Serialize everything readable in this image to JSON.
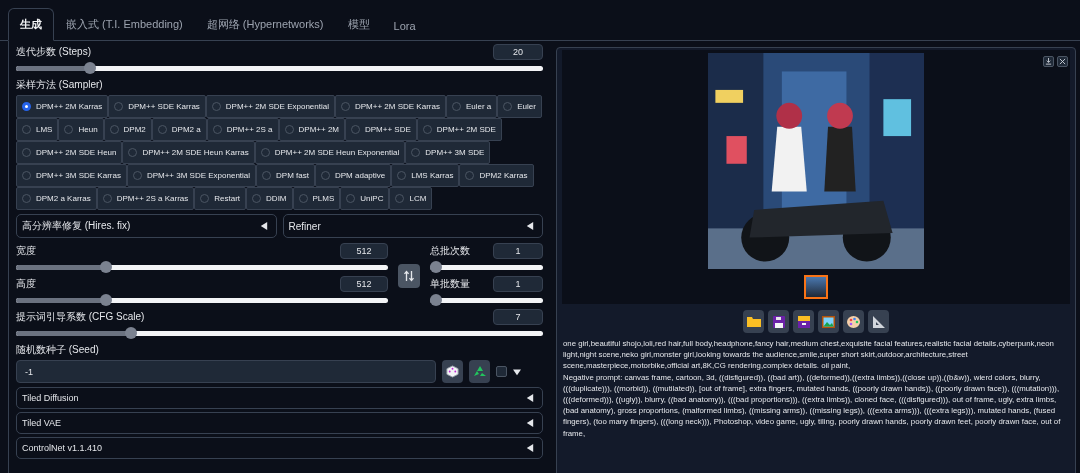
{
  "tabs": [
    {
      "label": "生成",
      "selected": true
    },
    {
      "label": "嵌入式 (T.I. Embedding)",
      "selected": false
    },
    {
      "label": "超网络 (Hypernetworks)",
      "selected": false
    },
    {
      "label": "模型",
      "selected": false
    },
    {
      "label": "Lora",
      "selected": false
    }
  ],
  "steps": {
    "label": "迭代步数 (Steps)",
    "value": "20",
    "level": 0.133
  },
  "sampler": {
    "label": "采样方法 (Sampler)",
    "options": [
      {
        "label": "DPM++ 2M Karras",
        "selected": true
      },
      {
        "label": "DPM++ SDE Karras",
        "selected": false
      },
      {
        "label": "DPM++ 2M SDE Exponential",
        "selected": false
      },
      {
        "label": "DPM++ 2M SDE Karras",
        "selected": false
      },
      {
        "label": "Euler a",
        "selected": false
      },
      {
        "label": "Euler",
        "selected": false
      },
      {
        "label": "LMS",
        "selected": false
      },
      {
        "label": "Heun",
        "selected": false
      },
      {
        "label": "DPM2",
        "selected": false
      },
      {
        "label": "DPM2 a",
        "selected": false
      },
      {
        "label": "DPM++ 2S a",
        "selected": false
      },
      {
        "label": "DPM++ 2M",
        "selected": false
      },
      {
        "label": "DPM++ SDE",
        "selected": false
      },
      {
        "label": "DPM++ 2M SDE",
        "selected": false
      },
      {
        "label": "DPM++ 2M SDE Heun",
        "selected": false
      },
      {
        "label": "DPM++ 2M SDE Heun Karras",
        "selected": false
      },
      {
        "label": "DPM++ 2M SDE Heun Exponential",
        "selected": false
      },
      {
        "label": "DPM++ 3M SDE",
        "selected": false
      },
      {
        "label": "DPM++ 3M SDE Karras",
        "selected": false
      },
      {
        "label": "DPM++ 3M SDE Exponential",
        "selected": false
      },
      {
        "label": "DPM fast",
        "selected": false
      },
      {
        "label": "DPM adaptive",
        "selected": false
      },
      {
        "label": "LMS Karras",
        "selected": false
      },
      {
        "label": "DPM2 Karras",
        "selected": false
      },
      {
        "label": "DPM2 a Karras",
        "selected": false
      },
      {
        "label": "DPM++ 2S a Karras",
        "selected": false
      },
      {
        "label": "Restart",
        "selected": false
      },
      {
        "label": "DDIM",
        "selected": false
      },
      {
        "label": "PLMS",
        "selected": false
      },
      {
        "label": "UniPC",
        "selected": false
      },
      {
        "label": "LCM",
        "selected": false
      }
    ]
  },
  "upper_accordions": [
    {
      "label": "高分辨率修复 (Hires. fix)",
      "expanded": false
    },
    {
      "label": "Refiner",
      "expanded": false
    }
  ],
  "width": {
    "label": "宽度",
    "value": "512",
    "level": 0.234
  },
  "height": {
    "label": "高度",
    "value": "512",
    "level": 0.234
  },
  "batch_count": {
    "label": "总批次数",
    "value": "1",
    "level": 0
  },
  "batch_size": {
    "label": "单批数量",
    "value": "1",
    "level": 0
  },
  "cfg_scale": {
    "label": "提示词引导系数 (CFG Scale)",
    "value": "7",
    "level": 0.212
  },
  "seed": {
    "label": "随机数种子 (Seed)",
    "value": "-1",
    "extra_checked": false
  },
  "lower_accordions": [
    {
      "label": "Tiled Diffusion",
      "expanded": false
    },
    {
      "label": "Tiled VAE",
      "expanded": false
    },
    {
      "label": "ControlNet v1.1.410",
      "expanded": false
    }
  ],
  "gallery": {
    "thumbnails": [
      {
        "selected": true
      }
    ]
  },
  "info": [
    "one girl,beautiful shojo,loli,red hair,full body,headphone,fancy hair,medium chest,exquisite facial features,realistic facial details,cyberpunk,neon light,night scene,neko girl,monster girl,looking towards the audience,smile,super short skirt,outdoor,architecture,street scene,masterpiece,motorbike,official art,8K,CG rendering,complex details. oil paint,",
    "Negative prompt: canvas frame, cartoon, 3d, ((disfigured)), ((bad art)), ((deformed)),((extra limbs)),((close up)),((b&w)), wierd colors, blurry, (((duplicate))), ((morbid)), ((mutilated)), [out of frame], extra fingers, mutated hands, ((poorly drawn hands)), ((poorly drawn face)), (((mutation))), (((deformed))), ((ugly)), blurry, ((bad anatomy)), (((bad proportions))), ((extra limbs)), cloned face, (((disfigured))), out of frame, ugly, extra limbs, (bad anatomy), gross proportions, (malformed limbs), ((missing arms)), ((missing legs)), (((extra arms))), (((extra legs))), mutated hands, (fused fingers), (too many fingers), (((long neck))), Photoshop, video game, ugly, tiling, poorly drawn hands, poorly drawn feet, poorly drawn face, out of frame,"
  ]
}
